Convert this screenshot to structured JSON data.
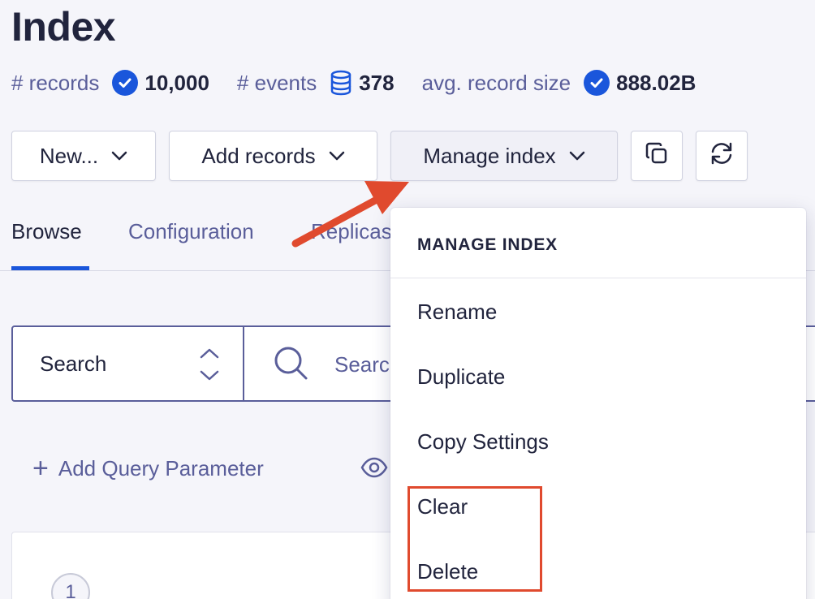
{
  "page": {
    "title": "Index"
  },
  "stats": [
    {
      "label": "# records",
      "value": "10,000",
      "icon": "check-circle-icon"
    },
    {
      "label": "# events",
      "value": "378",
      "icon": "database-icon"
    },
    {
      "label": "avg. record size",
      "value": "888.02B",
      "icon": "check-circle-icon"
    }
  ],
  "toolbar": {
    "new_label": "New...",
    "add_records_label": "Add records",
    "manage_index_label": "Manage index",
    "copy_icon": "copy-icon",
    "refresh_icon": "refresh-icon"
  },
  "tabs": [
    {
      "label": "Browse",
      "active": true
    },
    {
      "label": "Configuration",
      "active": false
    },
    {
      "label": "Replicas",
      "active": false
    }
  ],
  "search": {
    "mode_label": "Search",
    "placeholder": "Search"
  },
  "query": {
    "add_param_label": "Add Query Parameter"
  },
  "results": {
    "first_row_number": "1"
  },
  "dropdown": {
    "header": "MANAGE INDEX",
    "items": [
      "Rename",
      "Duplicate",
      "Copy Settings",
      "Clear",
      "Delete"
    ]
  },
  "colors": {
    "accent": "#1a56db",
    "annotation": "#e04a2e",
    "muted_text": "#5a5e9a"
  }
}
